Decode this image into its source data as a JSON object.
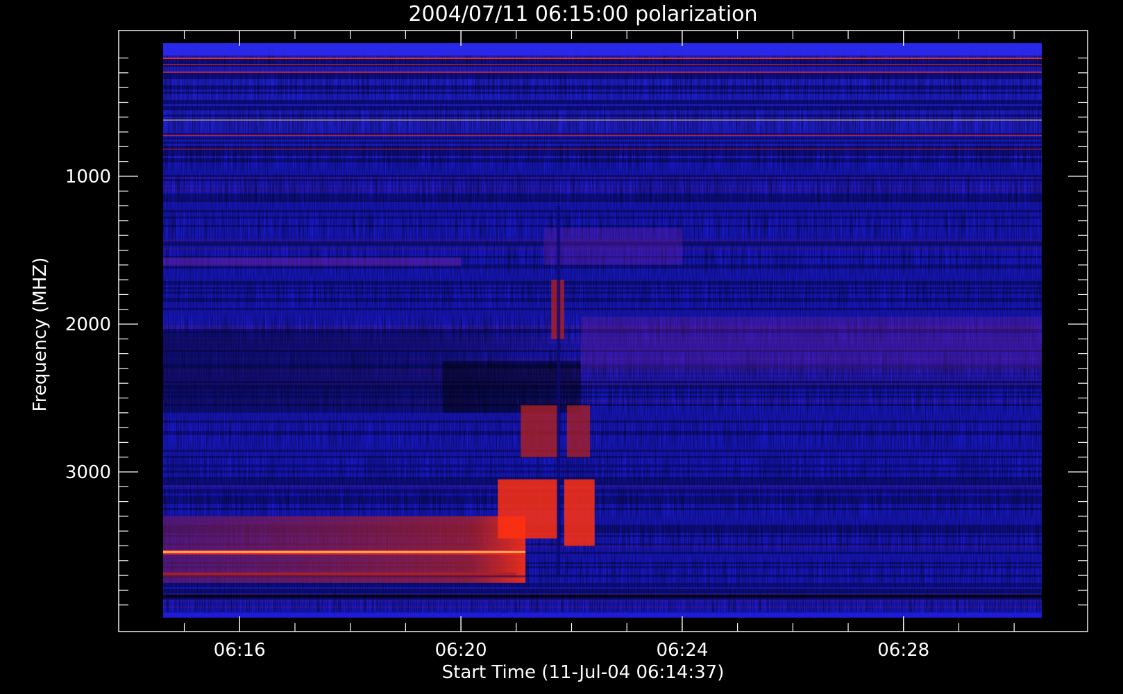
{
  "chart_data": {
    "type": "heatmap",
    "title": "2004/07/11 06:15:00 polarization",
    "xlabel": "Start Time (11-Jul-04 06:14:37)",
    "ylabel": "Frequency (MHZ)",
    "x_range_minutes": [
      "06:14:37",
      "06:30:30"
    ],
    "ylim": [
      4000,
      0
    ],
    "x_ticks": [
      {
        "label": "06:16",
        "value": "06:16"
      },
      {
        "label": "06:20",
        "value": "06:20"
      },
      {
        "label": "06:24",
        "value": "06:24"
      },
      {
        "label": "06:28",
        "value": "06:28"
      }
    ],
    "y_ticks": [
      {
        "label": "1000",
        "value": 1000
      },
      {
        "label": "2000",
        "value": 2000
      },
      {
        "label": "3000",
        "value": 3000
      }
    ],
    "colormap": [
      "#000000",
      "#0a0a70",
      "#1a1ad8",
      "#2a2af0",
      "#6a1f9e",
      "#b02020",
      "#ff3010",
      "#ffd890"
    ],
    "background_color": "#000000",
    "axis_color": "#ffffff"
  }
}
